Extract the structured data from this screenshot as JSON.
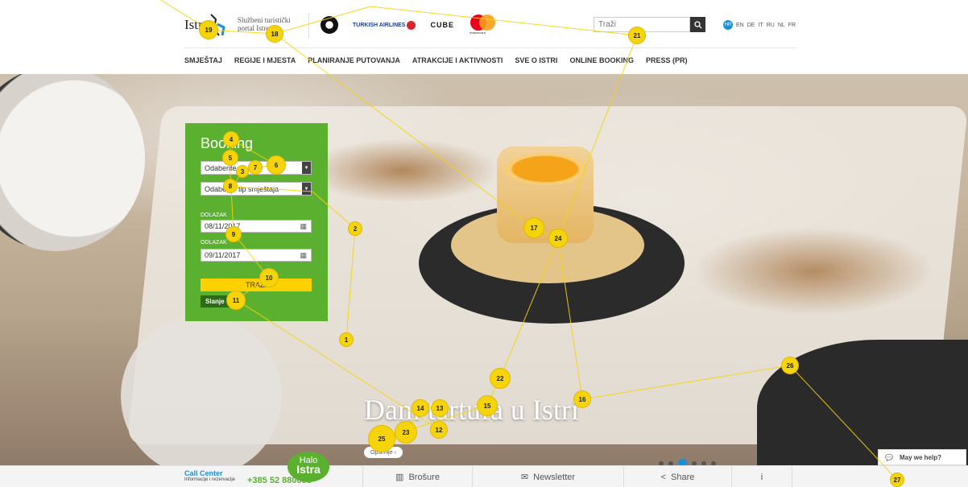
{
  "header": {
    "logo_text": "Istr",
    "logo_sub": "Službeni turistički portal Istre",
    "partners": [
      "BMW",
      "TURKISH AIRLINES",
      "CUBE",
      "mastercard"
    ],
    "search_placeholder": "Traži",
    "languages": [
      "HR",
      "EN",
      "DE",
      "IT",
      "RU",
      "NL",
      "FR"
    ],
    "active_language": "HR"
  },
  "nav": {
    "items": [
      "SMJEŠTAJ",
      "REGIJE I MJESTA",
      "PLANIRANJE PUTOVANJA",
      "ATRAKCIJE I AKTIVNOSTI",
      "SVE O ISTRI",
      "ONLINE BOOKING",
      "PRESS (PR)"
    ]
  },
  "booking": {
    "title": "Booking",
    "select_1": "Odaberite",
    "select_2": "Odaberite tip smještaja",
    "arrival_label": "DOLAZAK",
    "arrival_value": "08/11/2017",
    "departure_label": "ODLAZAK",
    "departure_value": "09/11/2017",
    "search_button": "TRAŽI",
    "send_button": "Slanje"
  },
  "hero": {
    "title": "Dani tartufa u Istri",
    "more_link": "Opširnije ›",
    "slides_total": 6,
    "slide_active": 2
  },
  "bottom": {
    "call_center_title": "Call Center",
    "call_center_sub": "Informacije i rezervacije",
    "phone": "+385 52 880088",
    "halo_1": "Halo",
    "halo_2": "Istra",
    "brochures": "Brošure",
    "newsletter": "Newsletter",
    "share": "Share",
    "info": "i",
    "help": "May we help?"
  },
  "colors": {
    "green": "#5bb12f",
    "yellow": "#ffd100",
    "blue": "#1a8fd6",
    "marker": "#f5d40c"
  },
  "markers": [
    "1",
    "2",
    "3",
    "4",
    "5",
    "6",
    "7",
    "8",
    "9",
    "10",
    "11",
    "12",
    "13",
    "14",
    "15",
    "16",
    "17",
    "18",
    "19",
    "21",
    "22",
    "23",
    "24",
    "25",
    "26",
    "27"
  ]
}
